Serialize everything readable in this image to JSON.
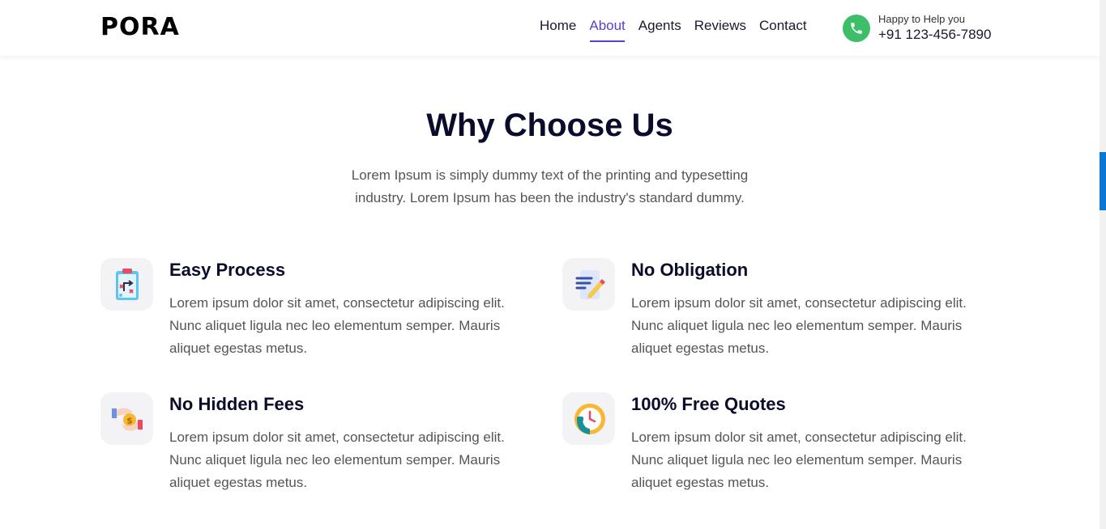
{
  "header": {
    "logo": "PORA",
    "nav": [
      {
        "label": "Home",
        "active": false
      },
      {
        "label": "About",
        "active": true
      },
      {
        "label": "Agents",
        "active": false
      },
      {
        "label": "Reviews",
        "active": false
      },
      {
        "label": "Contact",
        "active": false
      }
    ],
    "phone": {
      "label": "Happy to Help you",
      "number": "+91 123-456-7890",
      "icon": "phone-icon",
      "color": "#3dbf6a"
    }
  },
  "section": {
    "title": "Why Choose Us",
    "description": "Lorem Ipsum is simply dummy text of the printing and typesetting industry. Lorem Ipsum has been the industry's standard dummy."
  },
  "features": [
    {
      "title": "Easy Process",
      "text": "Lorem ipsum dolor sit amet, consectetur adipiscing elit. Nunc aliquet ligula nec leo elementum semper. Mauris aliquet egestas metus.",
      "icon": "clipboard-plan-icon"
    },
    {
      "title": "No Obligation",
      "text": "Lorem ipsum dolor sit amet, consectetur adipiscing elit. Nunc aliquet ligula nec leo elementum semper. Mauris aliquet egestas metus.",
      "icon": "document-pencil-icon"
    },
    {
      "title": "No Hidden Fees",
      "text": "Lorem ipsum dolor sit amet, consectetur adipiscing elit. Nunc aliquet ligula nec leo elementum semper. Mauris aliquet egestas metus.",
      "icon": "hand-coin-icon"
    },
    {
      "title": "100% Free Quotes",
      "text": "Lorem ipsum dolor sit amet, consectetur adipiscing elit. Nunc aliquet ligula nec leo elementum semper. Mauris aliquet egestas metus.",
      "icon": "clock-phone-icon"
    }
  ],
  "colors": {
    "accent": "#5b3fd1",
    "heading": "#0b0b2b",
    "body_text": "#555555",
    "scroll_thumb": "#0a77d5"
  }
}
